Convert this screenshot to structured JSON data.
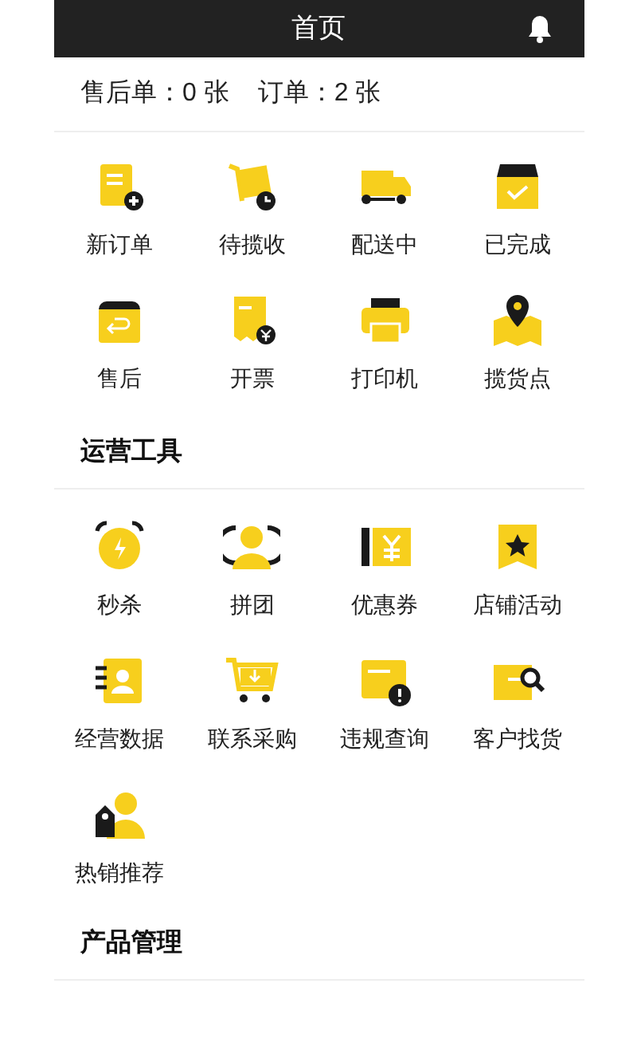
{
  "header": {
    "title": "首页"
  },
  "summary": [
    {
      "label": "售后单：",
      "value": "0 张"
    },
    {
      "label": "订单：",
      "value": "2 张"
    }
  ],
  "orders": [
    "新订单",
    "待揽收",
    "配送中",
    "已完成",
    "售后",
    "开票",
    "打印机",
    "揽货点"
  ],
  "sections": [
    {
      "title": "运营工具",
      "items": [
        "秒杀",
        "拼团",
        "优惠券",
        "店铺活动",
        "经营数据",
        "联系采购",
        "违规查询",
        "客户找货",
        "热销推荐"
      ]
    },
    {
      "title": "产品管理"
    }
  ]
}
